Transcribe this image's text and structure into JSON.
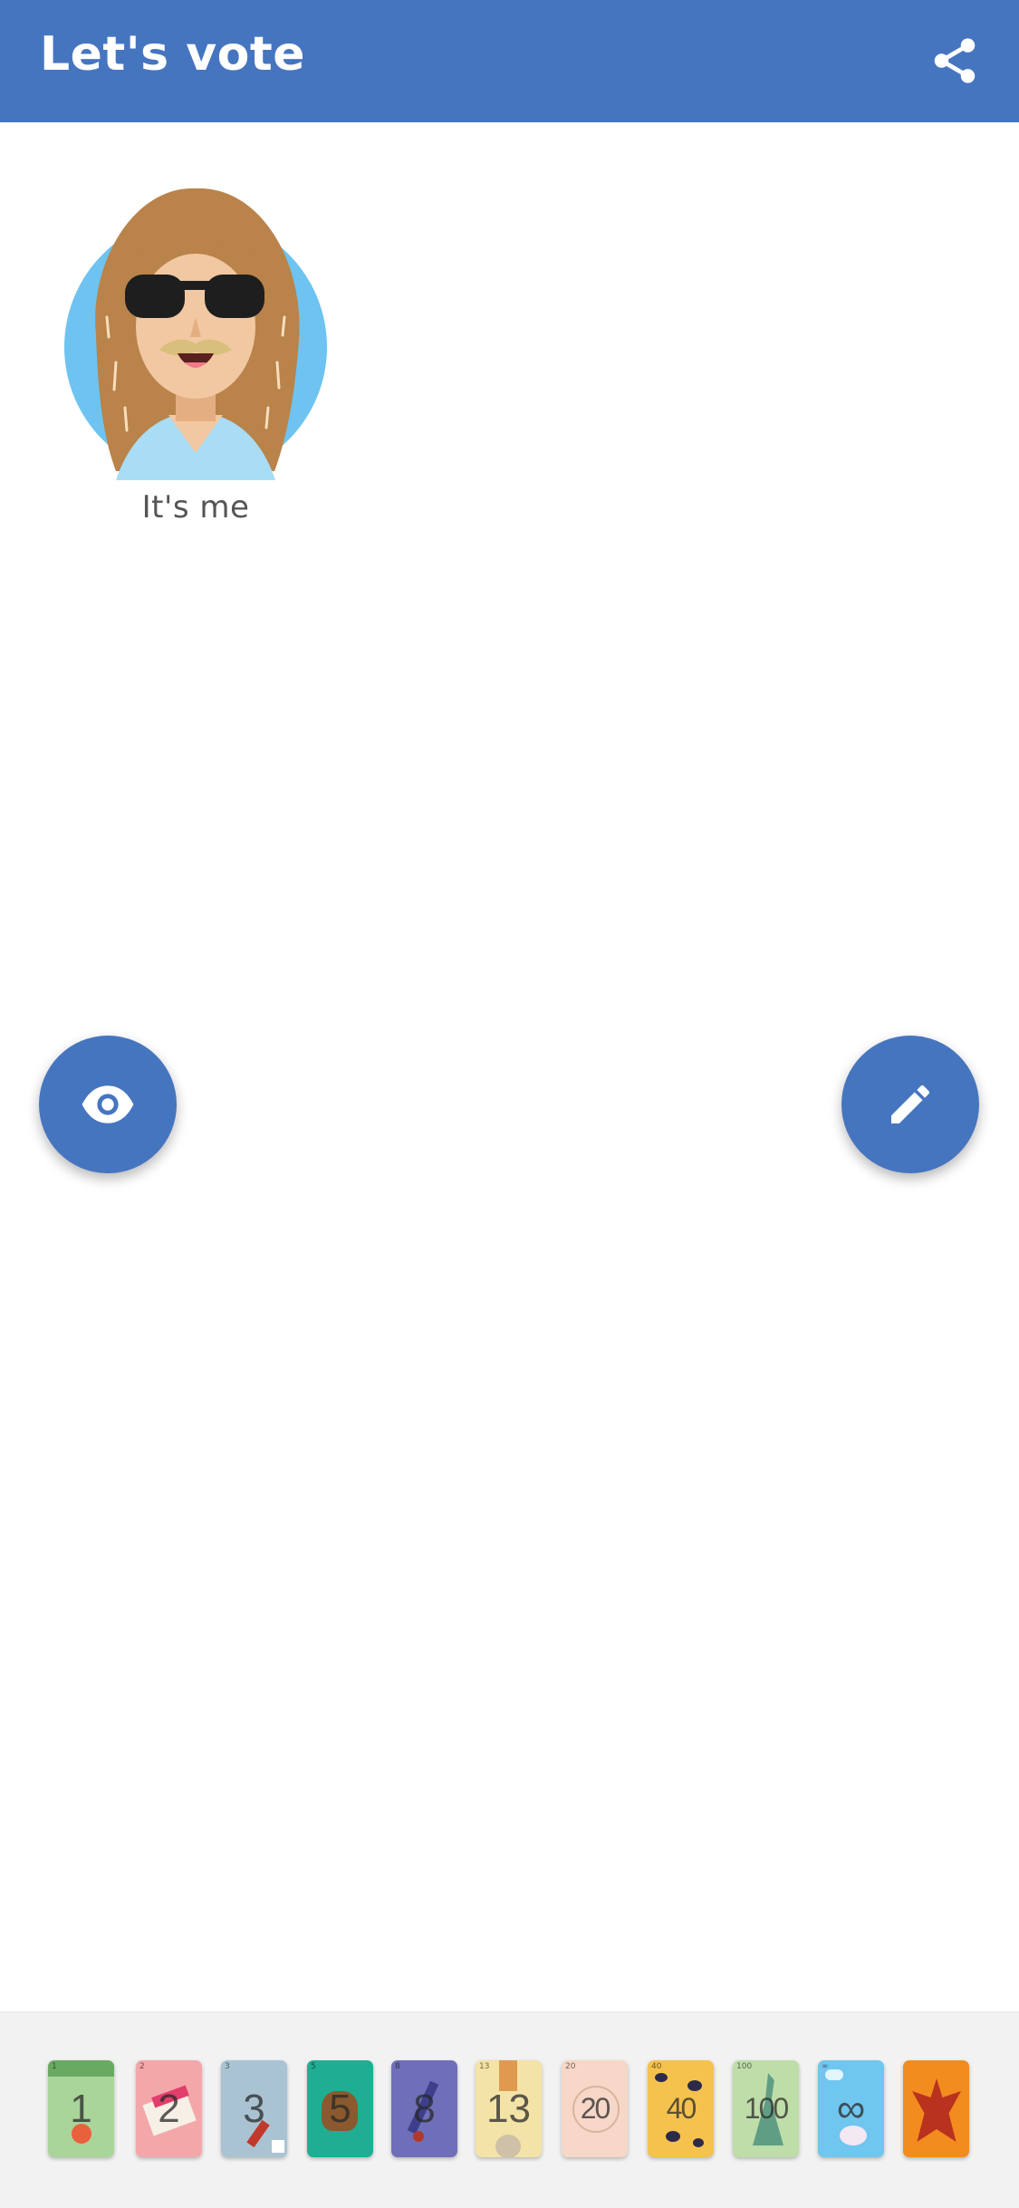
{
  "header": {
    "title": "Let's vote",
    "share_icon": "share-icon"
  },
  "participant": {
    "name": "It's me",
    "avatar": "avatar-woman-sunglasses"
  },
  "fabs": {
    "reveal_icon": "eye-icon",
    "edit_icon": "pencil-icon"
  },
  "cards": [
    {
      "label": "1",
      "color": "#A9D59A"
    },
    {
      "label": "2",
      "color": "#F4A7A9"
    },
    {
      "label": "3",
      "color": "#A9C3D3"
    },
    {
      "label": "5",
      "color": "#1FAE93"
    },
    {
      "label": "8",
      "color": "#6E6FB8"
    },
    {
      "label": "13",
      "color": "#F3E3A6"
    },
    {
      "label": "20",
      "color": "#F7D7C7"
    },
    {
      "label": "40",
      "color": "#F5C24E"
    },
    {
      "label": "100",
      "color": "#BFDDA8"
    },
    {
      "label": "∞",
      "color": "#6FC6EE"
    },
    {
      "label": "",
      "color": "#F28C1E"
    }
  ],
  "colors": {
    "primary": "#4675C0",
    "tray": "#f2f2f2"
  }
}
